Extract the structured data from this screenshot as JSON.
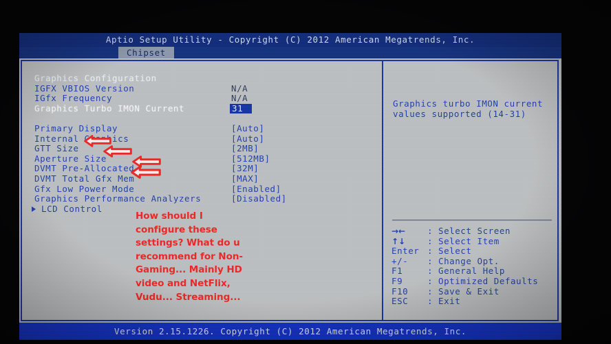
{
  "window": {
    "title": "Aptio Setup Utility - Copyright (C) 2012 American Megatrends, Inc.",
    "active_tab": "Chipset",
    "version_bar": "Version 2.15.1226. Copyright (C) 2012 American Megatrends, Inc."
  },
  "settings": {
    "section_header": "Graphics Configuration",
    "rows": [
      {
        "label": "Graphics Configuration",
        "value": "",
        "style": "section"
      },
      {
        "label": "IGFX VBIOS Version",
        "value": "N/A",
        "style": "plain"
      },
      {
        "label": "IGfx Frequency",
        "value": "N/A",
        "style": "plain"
      },
      {
        "label": "Graphics Turbo IMON Current",
        "value": "31",
        "style": "selected"
      },
      {
        "label": "",
        "value": "",
        "style": "spacer"
      },
      {
        "label": "Primary Display",
        "value": "[Auto]",
        "style": "normal"
      },
      {
        "label": "Internal Graphics",
        "value": "[Auto]",
        "style": "normal"
      },
      {
        "label": "GTT Size",
        "value": "[2MB]",
        "style": "normal"
      },
      {
        "label": "Aperture Size",
        "value": "[512MB]",
        "style": "normal"
      },
      {
        "label": "DVMT Pre-Allocated",
        "value": "[32M]",
        "style": "normal"
      },
      {
        "label": "DVMT Total Gfx Mem",
        "value": "[MAX]",
        "style": "normal"
      },
      {
        "label": "Gfx Low Power Mode",
        "value": "[Enabled]",
        "style": "normal"
      },
      {
        "label": "Graphics Performance Analyzers",
        "value": "[Disabled]",
        "style": "normal"
      },
      {
        "label": "LCD Control",
        "value": "",
        "style": "submenu"
      }
    ]
  },
  "help": {
    "description": "Graphics turbo IMON current\nvalues supported (14-31)",
    "keys": [
      {
        "key": "→←",
        "sep": ":",
        "desc": "Select Screen",
        "glyph": true
      },
      {
        "key": "↑↓",
        "sep": ":",
        "desc": "Select Item",
        "glyph": true
      },
      {
        "key": "Enter",
        "sep": ":",
        "desc": "Select",
        "glyph": false
      },
      {
        "key": "+/-",
        "sep": ":",
        "desc": "Change Opt.",
        "glyph": false
      },
      {
        "key": "F1",
        "sep": ":",
        "desc": "General Help",
        "glyph": false
      },
      {
        "key": "F9",
        "sep": ":",
        "desc": "Optimized Defaults",
        "glyph": false
      },
      {
        "key": "F10",
        "sep": ":",
        "desc": "Save & Exit",
        "glyph": false
      },
      {
        "key": "ESC",
        "sep": ":",
        "desc": "Exit",
        "glyph": false
      }
    ]
  },
  "annotation": {
    "question": "How should I configure these settings? What do u recommend for Non-Gaming... Mainly HD video and NetFlix, Vudu... Streaming...",
    "color": "#ef2424",
    "arrow_targets": [
      "GTT Size",
      "Aperture Size",
      "DVMT Pre-Allocated",
      "DVMT Total Gfx Mem"
    ]
  },
  "colors": {
    "screen_bg": "#b9bcbe",
    "title_bar": "#102a7a",
    "version_bar": "#1230c8",
    "text_blue": "#1f3fa8",
    "highlight_bg": "#1533a6",
    "annotation_red": "#ef2424"
  }
}
